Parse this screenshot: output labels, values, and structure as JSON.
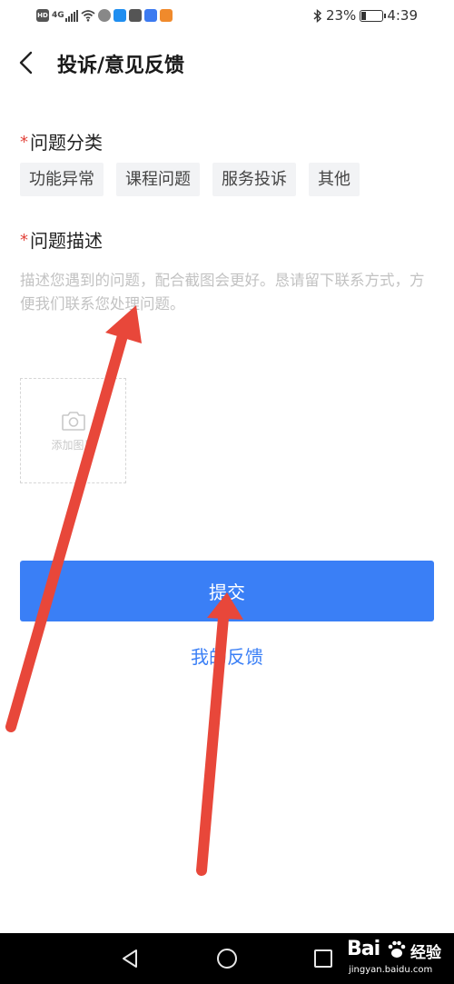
{
  "status_bar": {
    "hd": "HD",
    "network": "4G",
    "battery_text": "23%",
    "battery_level": 0.23,
    "time": "4:39",
    "icons": [
      "hd-icon",
      "signal-icon",
      "wifi-icon",
      "app-notification-icons",
      "bluetooth-icon",
      "battery-icon"
    ]
  },
  "header": {
    "back_icon": "chevron-left-icon",
    "title": "投诉/意见反馈"
  },
  "category": {
    "required_mark": "*",
    "label": "问题分类",
    "options": [
      "功能异常",
      "课程问题",
      "服务投诉",
      "其他"
    ]
  },
  "description": {
    "required_mark": "*",
    "label": "问题描述",
    "placeholder": "描述您遇到的问题，配合截图会更好。恳请留下联系方式，方便我们联系您处理问题。",
    "value": ""
  },
  "attachment": {
    "icon": "camera-icon",
    "label": "添加图片"
  },
  "actions": {
    "submit_label": "提交",
    "my_feedback_label": "我的反馈",
    "accent_color": "#3a7ff6"
  },
  "annotations": {
    "arrow_color": "#e8473a",
    "arrow_count": 2
  },
  "watermark": {
    "brand": "Bai",
    "brand_cn": "经验",
    "url": "jingyan.baidu.com"
  }
}
